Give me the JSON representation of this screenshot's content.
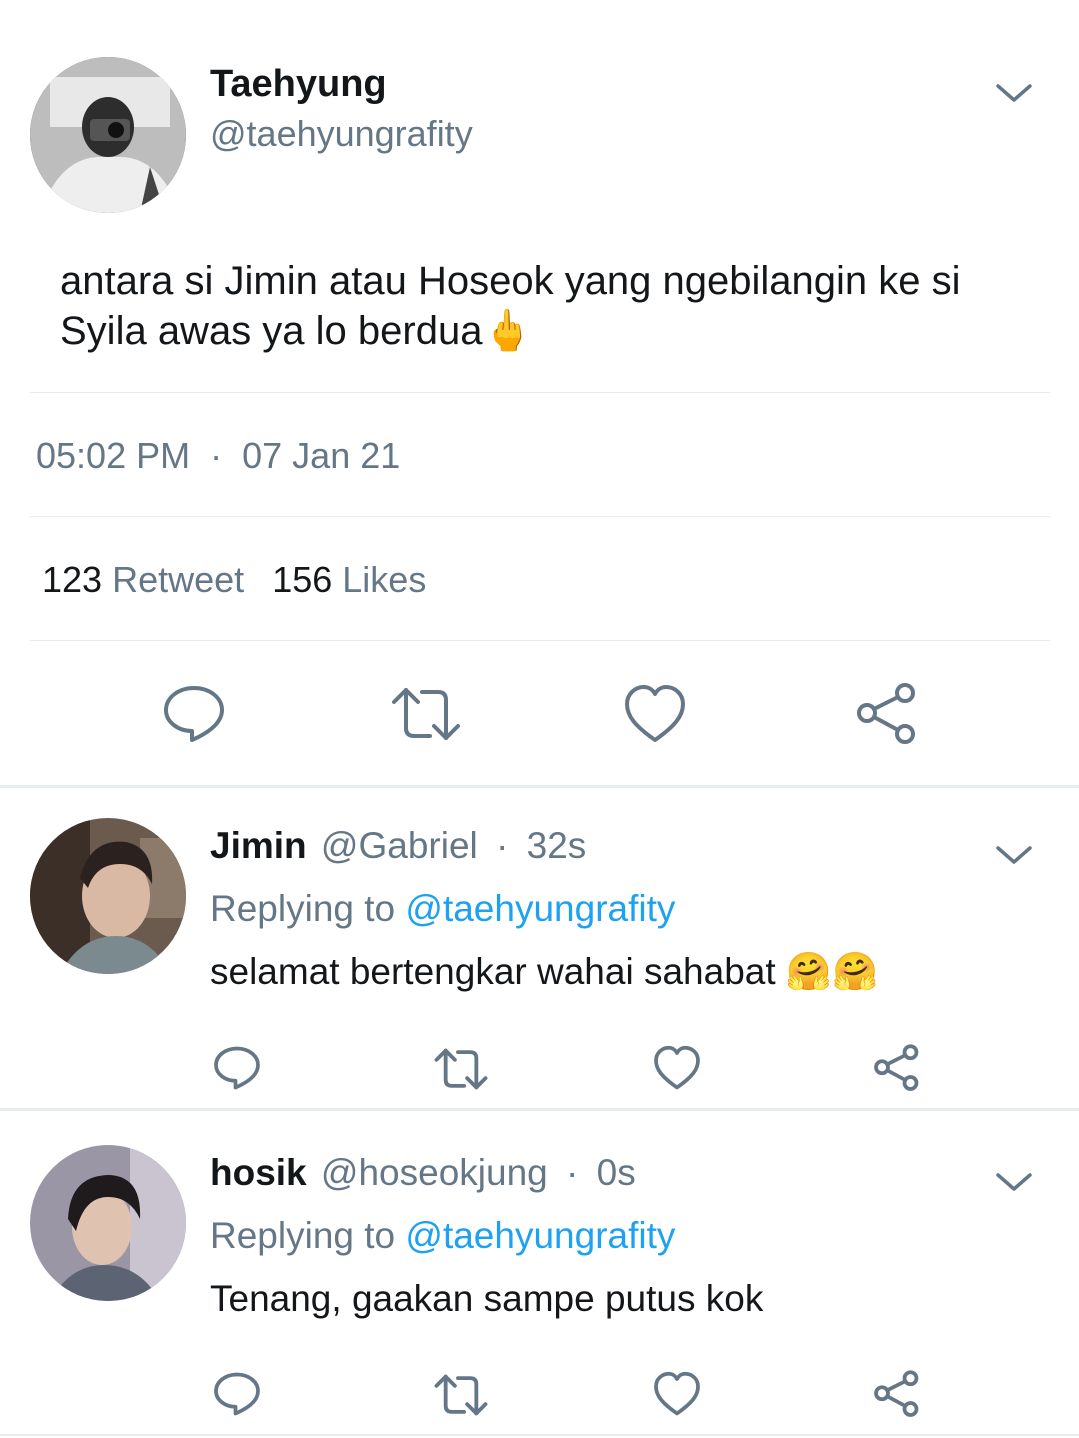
{
  "tweet": {
    "author_name": "Taehyung",
    "author_handle": "@taehyungrafity",
    "text": "antara si Jimin atau Hoseok yang ngebilangin ke si Syila awas ya lo berdua",
    "emoji": "🖕",
    "time": "05:02 PM",
    "sep": "·",
    "date": "07 Jan 21",
    "retweet_count": "123",
    "retweet_label": "Retweet",
    "like_count": "156",
    "like_label": "Likes"
  },
  "replies": [
    {
      "name": "Jimin",
      "handle": "@Gabriel",
      "sep": "·",
      "time": "32s",
      "replying_label": "Replying to",
      "replying_handle": "@taehyungrafity",
      "text": "selamat bertengkar wahai sahabat",
      "emoji": "🤗🤗"
    },
    {
      "name": "hosik",
      "handle": "@hoseokjung",
      "sep": "·",
      "time": "0s",
      "replying_label": "Replying to",
      "replying_handle": "@taehyungrafity",
      "text": "Tenang, gaakan sampe putus kok",
      "emoji": ""
    }
  ],
  "colors": {
    "muted": "#657786",
    "link": "#1da1f2",
    "divider": "#e6ecf0"
  },
  "icons": [
    "chevron-down-icon",
    "reply-icon",
    "retweet-icon",
    "like-icon",
    "share-icon"
  ]
}
